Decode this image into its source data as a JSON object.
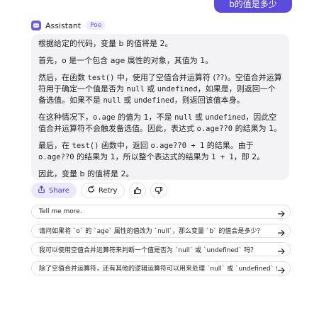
{
  "user_message": {
    "text": "b的值是多少"
  },
  "assistant": {
    "name": "Assistant",
    "badge": "Poe"
  },
  "message": {
    "p1": "根据给定的代码，变量 b 的值将是 2。",
    "p2": "首先，o 是一个包含 age 属性的对象，其值为 1。",
    "p3a": "然后，在函数 ",
    "p3b": "test()",
    "p3c": " 中，使用了空值合并运算符 (??)。空值合并运算符用于确定一个值是否为 ",
    "p3d": "null",
    "p3e": " 或 ",
    "p3f": "undefined",
    "p3g": "，如果是，则返回一个备选值。如果不是 ",
    "p3h": "null",
    "p3i": " 或 ",
    "p3j": "undefined",
    "p3k": "，则返回该值本身。",
    "p4a": "在这种情况下，",
    "p4b": "o.age",
    "p4c": " 的值为 1，不是 ",
    "p4d": "null",
    "p4e": " 或 ",
    "p4f": "undefined",
    "p4g": "，因此空值合并运算符不会触发备选值。因此，表达式 ",
    "p4h": "o.age??0",
    "p4i": " 的结果为 1。",
    "p5a": "最后，在 ",
    "p5b": "test()",
    "p5c": " 函数中，返回 ",
    "p5d": "o.age??0 + 1",
    "p5e": " 的结果。由于 ",
    "p5f": "o.age??0",
    "p5g": " 的结果为 1，所以整个表达式的结果为 ",
    "p5h": "1 + 1",
    "p5i": "，即 2。",
    "p6": "因此，变量 b 的值将是 2。"
  },
  "actions": {
    "share_label": "Share",
    "retry_label": "Retry"
  },
  "suggestions": [
    "Tell me more.",
    "请问如果将 `o` 的 `age` 属性的值改为 `null`，那么变量 `b` 的值会是多少？",
    "我可以使用空值合并运算符来判断一个值是否为 `null` 或 `undefined` 吗？",
    "除了空值合并运算符，还有其他的逻辑运算符可以用来处理 `null` 或 `undefined` 值吗？"
  ],
  "colors": {
    "accent": "#5b4bdb",
    "bubble": "#f3f3f5",
    "share_bg": "#ece8ff"
  },
  "icons": {
    "avatar": "robot-chat-icon",
    "share": "share-icon",
    "retry": "retry-icon",
    "like": "thumbs-up-icon",
    "dislike": "thumbs-down-icon",
    "send": "arrow-right-icon"
  }
}
